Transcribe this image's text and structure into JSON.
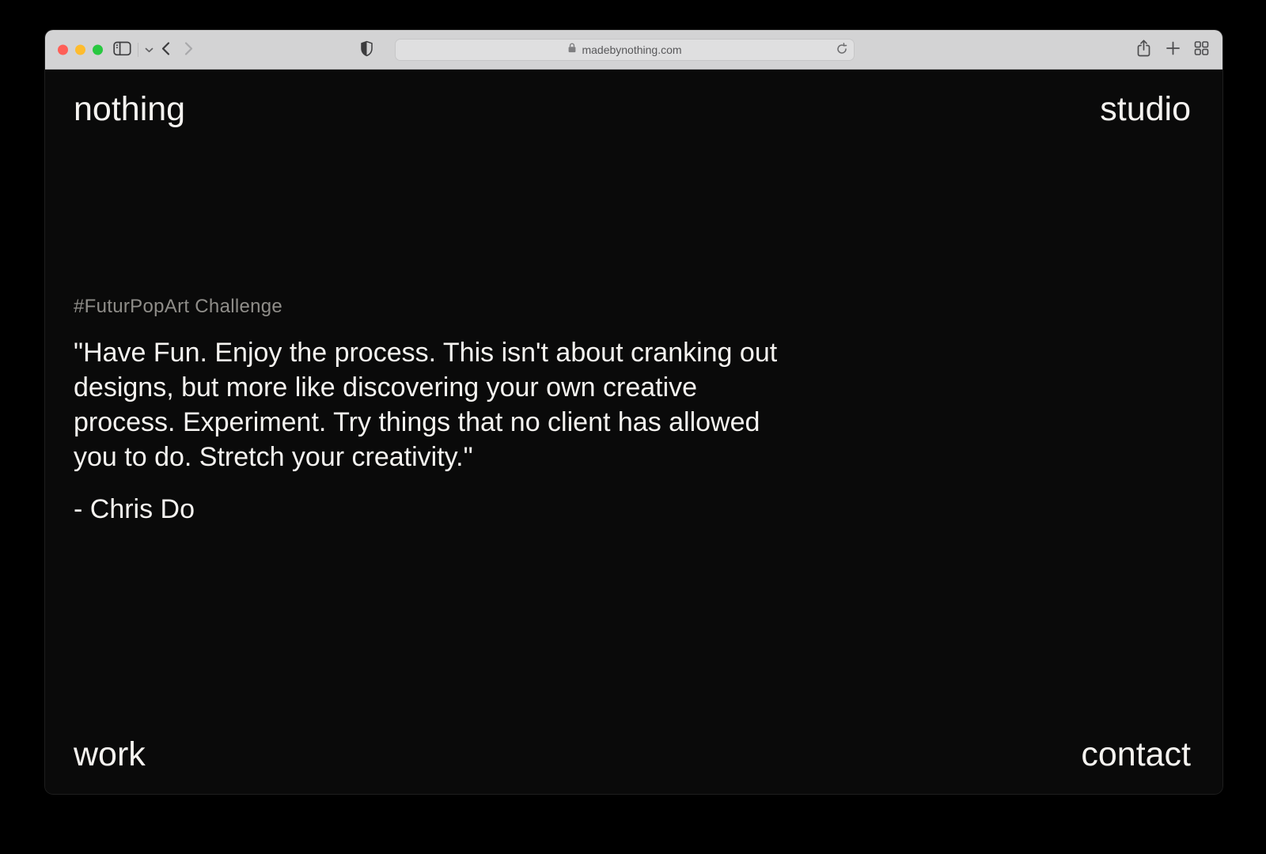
{
  "browser": {
    "url": "madebynothing.com",
    "window_controls": {
      "close": "#ff5f57",
      "minimize": "#febc2e",
      "zoom": "#28c840"
    },
    "icons": {
      "sidebar": "sidebar-toggle-icon",
      "sidebar_dropdown": "chevron-down-icon",
      "back": "chevron-left-icon",
      "forward": "chevron-right-icon",
      "privacy": "shield-icon",
      "lock": "lock-icon",
      "reload": "reload-icon",
      "share": "share-icon",
      "new_tab": "plus-icon",
      "tab_overview": "grid-icon"
    }
  },
  "page": {
    "brand": "nothing",
    "nav": {
      "studio": "studio",
      "work": "work",
      "contact": "contact"
    },
    "challenge_tag": "#FuturPopArt Challenge",
    "quote_lines": [
      "\"Have Fun. Enjoy the process. This isn't about cranking out",
      "designs, but more like discovering your own creative",
      "process. Experiment. Try things that no client has allowed",
      "you to do. Stretch your creativity.\"",
      ""
    ],
    "attribution": "- Chris Do"
  },
  "colors": {
    "outside_background": "#000000",
    "page_background": "#0a0a0a",
    "toolbar_background": "#d3d3d4",
    "address_field_background": "#dfdfe0",
    "text_primary": "#f5f3f0",
    "text_tag": "#8f8d89",
    "url_text": "#58585a"
  }
}
